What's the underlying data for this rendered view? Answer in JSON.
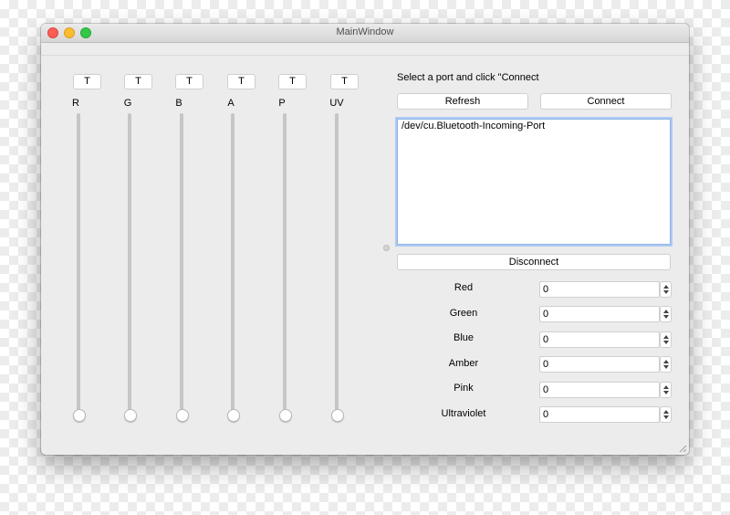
{
  "window": {
    "title": "MainWindow"
  },
  "channels": [
    {
      "label": "R",
      "toggle": "T"
    },
    {
      "label": "G",
      "toggle": "T"
    },
    {
      "label": "B",
      "toggle": "T"
    },
    {
      "label": "A",
      "toggle": "T"
    },
    {
      "label": "P",
      "toggle": "T"
    },
    {
      "label": "UV",
      "toggle": "T"
    }
  ],
  "port": {
    "prompt": "Select a port and click \"Connect",
    "refresh_label": "Refresh",
    "connect_label": "Connect",
    "disconnect_label": "Disconnect",
    "ports": [
      "/dev/cu.Bluetooth-Incoming-Port"
    ]
  },
  "fields": [
    {
      "label": "Red",
      "value": "0"
    },
    {
      "label": "Green",
      "value": "0"
    },
    {
      "label": "Blue",
      "value": "0"
    },
    {
      "label": "Amber",
      "value": "0"
    },
    {
      "label": "Pink",
      "value": "0"
    },
    {
      "label": "Ultraviolet",
      "value": "0"
    }
  ],
  "sliders": {
    "levels": [
      0,
      0,
      0,
      0,
      0,
      0
    ]
  },
  "colors": {
    "close": "#fc5d57",
    "minimize": "#fdbc2f",
    "maximize": "#33c748",
    "focus_ring": "#8fb4e8"
  }
}
